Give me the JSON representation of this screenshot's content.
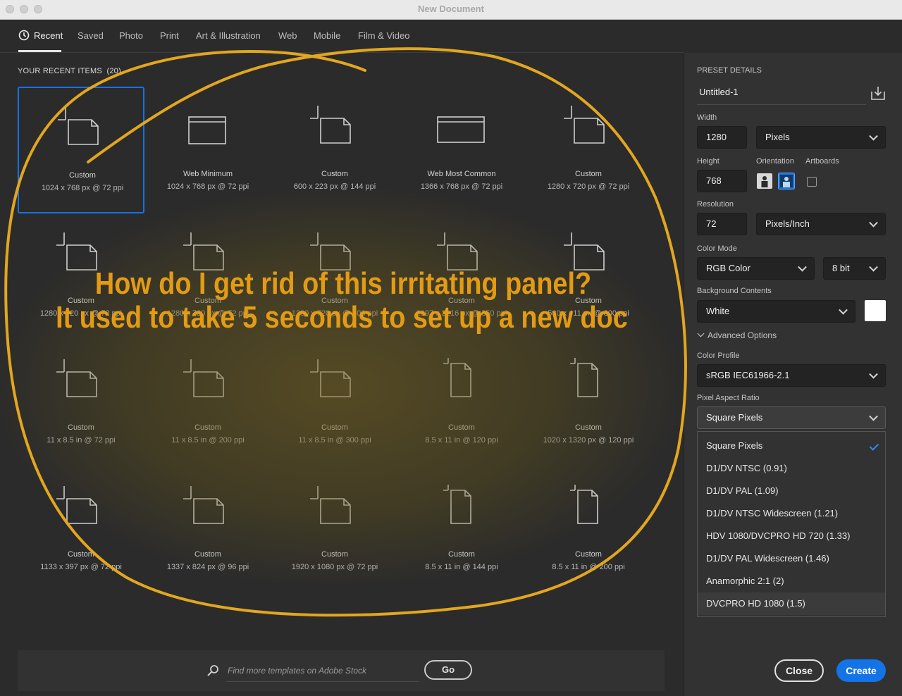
{
  "window": {
    "title": "New Document"
  },
  "tabs": [
    {
      "label": "Recent",
      "active": true
    },
    {
      "label": "Saved"
    },
    {
      "label": "Photo"
    },
    {
      "label": "Print"
    },
    {
      "label": "Art & Illustration"
    },
    {
      "label": "Web"
    },
    {
      "label": "Mobile"
    },
    {
      "label": "Film & Video"
    }
  ],
  "recent": {
    "section_label": "YOUR RECENT ITEMS",
    "count": "(20)",
    "items": [
      {
        "name": "Custom",
        "dims": "1024 x 768 px @ 72 ppi",
        "icon": "document-icon",
        "selected": true
      },
      {
        "name": "Web Minimum",
        "dims": "1024 x 768 px @ 72 ppi",
        "icon": "browser-window-icon"
      },
      {
        "name": "Custom",
        "dims": "600 x 223 px @ 144 ppi",
        "icon": "document-icon"
      },
      {
        "name": "Web Most Common",
        "dims": "1366 x 768 px @ 72 ppi",
        "icon": "browser-window-icon"
      },
      {
        "name": "Custom",
        "dims": "1280 x 720 px @ 72 ppi",
        "icon": "document-icon"
      },
      {
        "name": "Custom",
        "dims": "1280 x 720 px @ 72 ppi",
        "icon": "document-icon"
      },
      {
        "name": "Custom",
        "dims": "1280 x 720 px @ 72 ppi",
        "icon": "document-icon"
      },
      {
        "name": "Custom",
        "dims": "1280 x 720 px @ 300 ppi",
        "icon": "document-icon"
      },
      {
        "name": "Custom",
        "dims": "2997 x 2216 px @ 350 ppi",
        "icon": "document-icon"
      },
      {
        "name": "Custom",
        "dims": "530 x 411 px @ 300 ppi",
        "icon": "document-icon"
      },
      {
        "name": "Custom",
        "dims": "11 x 8.5 in @ 72 ppi",
        "icon": "document-icon"
      },
      {
        "name": "Custom",
        "dims": "11 x 8.5 in @ 200 ppi",
        "icon": "document-icon"
      },
      {
        "name": "Custom",
        "dims": "11 x 8.5 in @ 300 ppi",
        "icon": "document-icon"
      },
      {
        "name": "Custom",
        "dims": "8.5 x 11 in @ 120 ppi",
        "icon": "document-portrait-icon"
      },
      {
        "name": "Custom",
        "dims": "1020 x 1320 px @ 120 ppi",
        "icon": "document-portrait-icon"
      },
      {
        "name": "Custom",
        "dims": "1133 x 397 px @ 72 ppi",
        "icon": "document-icon"
      },
      {
        "name": "Custom",
        "dims": "1337 x 824 px @ 96 ppi",
        "icon": "document-icon"
      },
      {
        "name": "Custom",
        "dims": "1920 x 1080 px @ 72 ppi",
        "icon": "document-icon"
      },
      {
        "name": "Custom",
        "dims": "8.5 x 11 in @ 144 ppi",
        "icon": "document-portrait-icon"
      },
      {
        "name": "Custom",
        "dims": "8.5 x 11 in @ 200 ppi",
        "icon": "document-portrait-icon"
      }
    ]
  },
  "search": {
    "placeholder": "Find more templates on Adobe Stock",
    "go_label": "Go"
  },
  "preset": {
    "section_label": "PRESET DETAILS",
    "doc_name": "Untitled-1",
    "width_label": "Width",
    "width_value": "1280",
    "width_unit": "Pixels",
    "height_label": "Height",
    "height_value": "768",
    "orientation_label": "Orientation",
    "artboards_label": "Artboards",
    "resolution_label": "Resolution",
    "resolution_value": "72",
    "resolution_unit": "Pixels/Inch",
    "color_mode_label": "Color Mode",
    "color_mode": "RGB Color",
    "bit_depth": "8 bit",
    "bg_label": "Background Contents",
    "bg_value": "White",
    "advanced_label": "Advanced Options",
    "profile_label": "Color Profile",
    "profile_value": "sRGB IEC61966-2.1",
    "par_label": "Pixel Aspect Ratio",
    "par_value": "Square Pixels",
    "par_options": [
      "Square Pixels",
      "D1/DV NTSC (0.91)",
      "D1/DV PAL (1.09)",
      "D1/DV NTSC Widescreen (1.21)",
      "HDV 1080/DVCPRO HD 720 (1.33)",
      "D1/DV PAL Widescreen (1.46)",
      "Anamorphic 2:1 (2)",
      "DVCPRO HD 1080 (1.5)"
    ],
    "close_label": "Close",
    "create_label": "Create"
  },
  "annotation": {
    "line1": "How do I get rid of this irritating panel?",
    "line2": "It used to take 5 seconds to set up a new doc"
  },
  "colors": {
    "accent": "#1473e6",
    "annotation": "#e39b14",
    "panel_bg": "#2b2b2b",
    "details_bg": "#323232"
  }
}
